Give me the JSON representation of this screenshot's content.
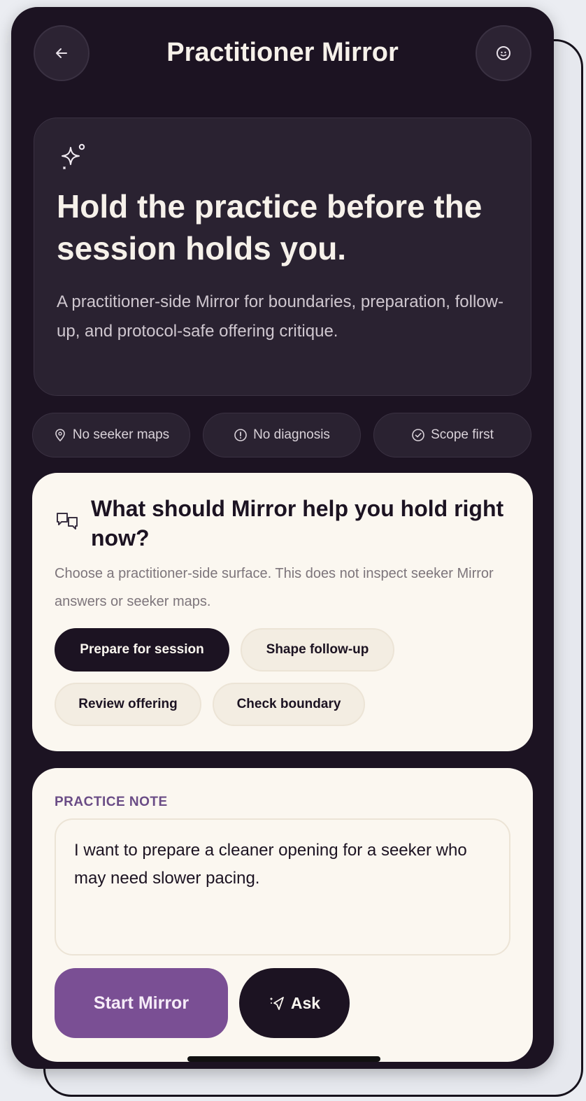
{
  "header": {
    "title": "Practitioner Mirror",
    "back_icon": "arrow-left-icon",
    "avatar_icon": "smiley-face-icon"
  },
  "hero": {
    "icon": "sparkle-icon",
    "title": "Hold the practice before the session holds you.",
    "description": "A practitioner-side Mirror for boundaries, preparation, follow-up, and protocol-safe offering critique."
  },
  "chips": [
    {
      "label": "No seeker maps",
      "icon": "location-pin-icon"
    },
    {
      "label": "No diagnosis",
      "icon": "info-circle-icon"
    },
    {
      "label": "Scope first",
      "icon": "check-circle-icon"
    }
  ],
  "help": {
    "icon": "chat-bubbles-icon",
    "title": "What should Mirror help you hold right now?",
    "description": "Choose a practitioner-side surface. This does not inspect seeker Mirror answers or seeker maps.",
    "options": [
      {
        "label": "Prepare for session",
        "selected": true
      },
      {
        "label": "Shape follow-up",
        "selected": false
      },
      {
        "label": "Review offering",
        "selected": false
      },
      {
        "label": "Check boundary",
        "selected": false
      }
    ]
  },
  "note": {
    "label": "PRACTICE NOTE",
    "value": "I want to prepare a cleaner opening for a seeker who may need slower pacing."
  },
  "actions": {
    "start_label": "Start Mirror",
    "ask_label": "Ask",
    "ask_icon": "send-sparkle-icon"
  },
  "colors": {
    "background": "#1c1322",
    "card_dark": "#2a2231",
    "card_light": "#fbf7f0",
    "accent_purple": "#7a4f94",
    "text_light": "#f6f1ea"
  }
}
